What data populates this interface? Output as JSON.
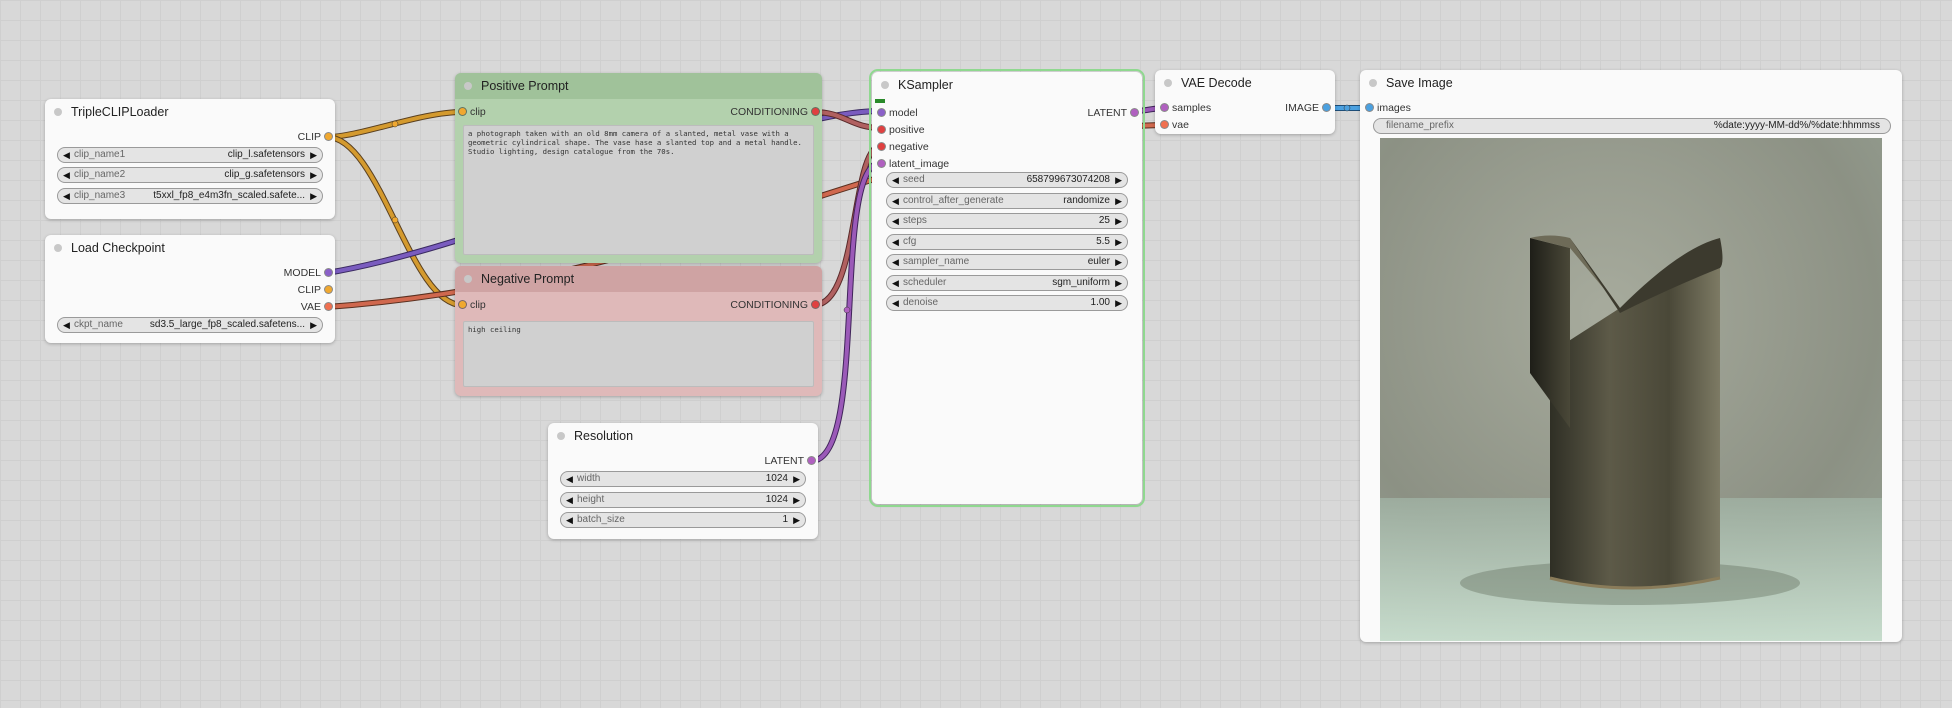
{
  "nodes": {
    "triple_clip": {
      "title": "TripleCLIPLoader",
      "output": "CLIP",
      "widgets": [
        {
          "label": "clip_name1",
          "value": "clip_l.safetensors"
        },
        {
          "label": "clip_name2",
          "value": "clip_g.safetensors"
        },
        {
          "label": "clip_name3",
          "value": "t5xxl_fp8_e4m3fn_scaled.safete..."
        }
      ]
    },
    "load_checkpoint": {
      "title": "Load Checkpoint",
      "outputs": [
        "MODEL",
        "CLIP",
        "VAE"
      ],
      "widgets": [
        {
          "label": "ckpt_name",
          "value": "sd3.5_large_fp8_scaled.safetens..."
        }
      ]
    },
    "positive": {
      "title": "Positive Prompt",
      "input": "clip",
      "output": "CONDITIONING",
      "text": "a photograph taken with an old 8mm camera of a slanted, metal vase with a geometric cylindrical shape. The vase hase a slanted top and a metal handle. Studio lighting, design catalogue from the 70s."
    },
    "negative": {
      "title": "Negative Prompt",
      "input": "clip",
      "output": "CONDITIONING",
      "text": "high ceiling"
    },
    "resolution": {
      "title": "Resolution",
      "output": "LATENT",
      "widgets": [
        {
          "label": "width",
          "value": "1024"
        },
        {
          "label": "height",
          "value": "1024"
        },
        {
          "label": "batch_size",
          "value": "1"
        }
      ]
    },
    "ksampler": {
      "title": "KSampler",
      "inputs": [
        "model",
        "positive",
        "negative",
        "latent_image"
      ],
      "output": "LATENT",
      "widgets": [
        {
          "label": "seed",
          "value": "658799673074208"
        },
        {
          "label": "control_after_generate",
          "value": "randomize"
        },
        {
          "label": "steps",
          "value": "25"
        },
        {
          "label": "cfg",
          "value": "5.5"
        },
        {
          "label": "sampler_name",
          "value": "euler"
        },
        {
          "label": "scheduler",
          "value": "sgm_uniform"
        },
        {
          "label": "denoise",
          "value": "1.00"
        }
      ]
    },
    "vae_decode": {
      "title": "VAE Decode",
      "inputs": [
        "samples",
        "vae"
      ],
      "output": "IMAGE"
    },
    "save_image": {
      "title": "Save Image",
      "input": "images",
      "widgets": [
        {
          "label": "filename_prefix",
          "value": "%date:yyyy-MM-dd%/%date:hhmmss"
        }
      ]
    }
  },
  "colors": {
    "clip": "#f0a830",
    "model": "#8a60c8",
    "vae": "#f07050",
    "conditioning": "#e04040",
    "latent": "#b060c0",
    "image": "#4aa0e0",
    "wire_model": "#7a5cbf",
    "wire_clip": "#d49a2e",
    "wire_vae": "#d0684e",
    "wire_cond": "#b06060",
    "wire_latent": "#9b5ab8"
  }
}
